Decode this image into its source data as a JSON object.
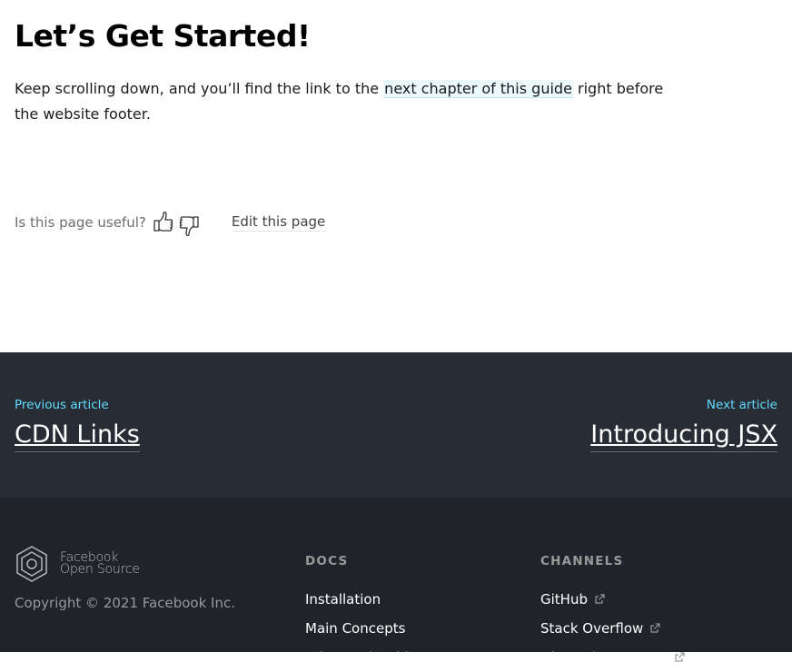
{
  "article": {
    "heading": "Let’s Get Started!",
    "paragraph_before": "Keep scrolling down, and you’ll find the link to the ",
    "paragraph_link": "next chapter of this guide",
    "paragraph_after": " right before the website footer."
  },
  "feedback": {
    "question": "Is this page useful?",
    "thumbs_up_icon": "thumbs-up-icon",
    "thumbs_down_icon": "thumbs-down-icon",
    "edit_label": "Edit this page"
  },
  "article_nav": {
    "prev_caption": "Previous article",
    "prev_title": "CDN Links",
    "next_caption": "Next article",
    "next_title": "Introducing JSX",
    "accent_color": "#61dafb"
  },
  "footer": {
    "logo_line1": "Facebook",
    "logo_line2": "Open Source",
    "copyright": "Copyright © 2021 Facebook Inc.",
    "docs_title": "DOCS",
    "docs_items": [
      "Installation",
      "Main Concepts",
      "Advanced Guides"
    ],
    "channels_title": "CHANNELS",
    "channels_items": [
      "GitHub",
      "Stack Overflow",
      "Discussion Forums"
    ]
  },
  "colors": {
    "nav_bg": "#282c34",
    "footer_bg": "#20232a",
    "link_highlight": "#ebf9fc"
  }
}
